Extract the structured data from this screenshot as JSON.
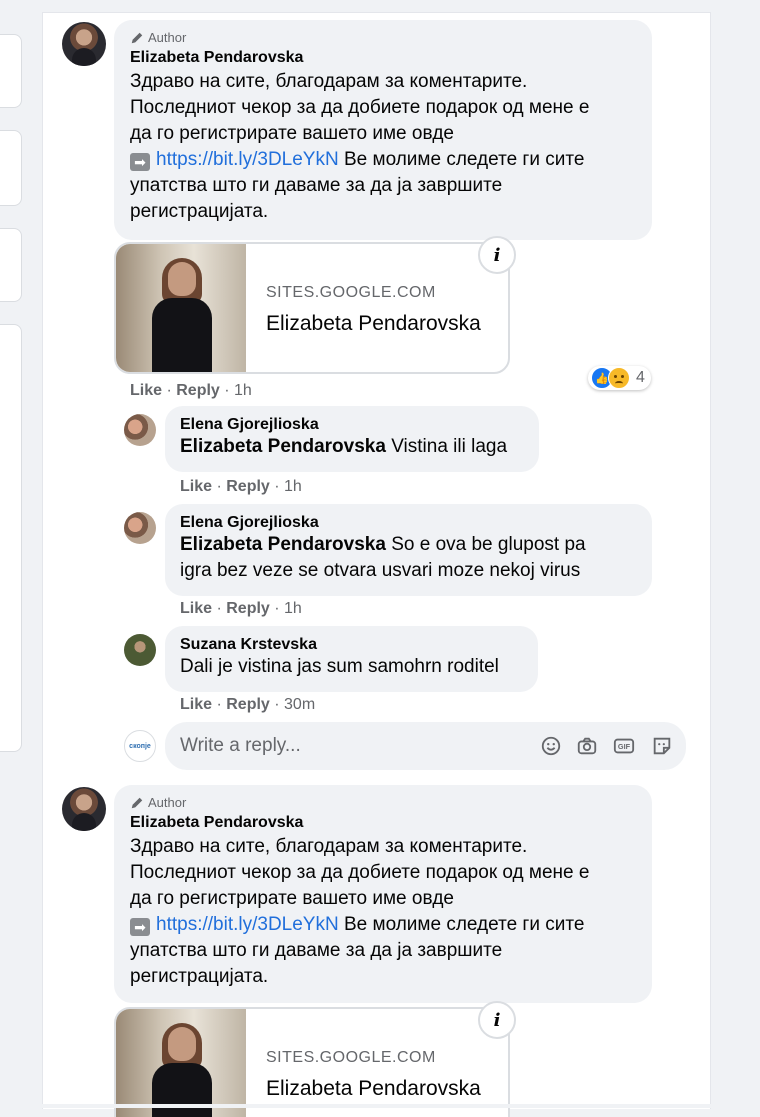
{
  "post1": {
    "author_tag": "Author",
    "name": "Elizabeta Pendarovska",
    "lines": [
      "Здраво на сите, благодарам за коментарите.",
      "Последниот чекор за да добиете подарок од мене е",
      "да го регистрирате вашето име овде"
    ],
    "link": "https://bit.ly/3DLeYkN",
    "after_link": " Ве молиме следете ги сите",
    "lines2": [
      "упатства што ги даваме за да ја завршите",
      "регистрацијата."
    ],
    "preview_domain": "SITES.GOOGLE.COM",
    "preview_title": "Elizabeta Pendarovska",
    "actions": {
      "like": "Like",
      "reply": "Reply",
      "time": "1h"
    },
    "reaction_count": "4"
  },
  "replies": [
    {
      "name": "Elena Gjorejlioska",
      "mention": "Elizabeta Pendarovska",
      "text": " Vistina ili laga",
      "like": "Like",
      "reply": "Reply",
      "time": "1h"
    },
    {
      "name": "Elena Gjorejlioska",
      "mention": "Elizabeta Pendarovska",
      "text": " So e ova be glupost pa",
      "text2": "igra bez veze se otvara usvari moze nekoj virus",
      "like": "Like",
      "reply": "Reply",
      "time": "1h"
    },
    {
      "name": "Suzana Krstevska",
      "text": "Dali je vistina jas sum samohrn roditel",
      "like": "Like",
      "reply": "Reply",
      "time": "30m"
    }
  ],
  "reply_input": {
    "placeholder": "Write a reply...",
    "avatar_text": "скопје"
  },
  "post2": {
    "author_tag": "Author",
    "name": "Elizabeta Pendarovska",
    "lines": [
      "Здраво на сите, благодарам за коментарите.",
      "Последниот чекор за да добиете подарок од мене е",
      "да го регистрирате вашето име овде"
    ],
    "link": "https://bit.ly/3DLeYkN",
    "after_link": " Ве молиме следете ги сите",
    "lines2": [
      "упатства што ги даваме за да ја завршите",
      "регистрацијата."
    ],
    "preview_domain": "SITES.GOOGLE.COM",
    "preview_title": "Elizabeta Pendarovska"
  },
  "icons": [
    "pen-icon",
    "info-icon",
    "emoji-icon",
    "camera-icon",
    "gif-icon",
    "sticker-icon",
    "arrow-right-icon"
  ],
  "colors": {
    "link": "#216fdb",
    "bubble": "#f0f2f5",
    "muted": "#65676b",
    "like_blue": "#1877f2"
  }
}
